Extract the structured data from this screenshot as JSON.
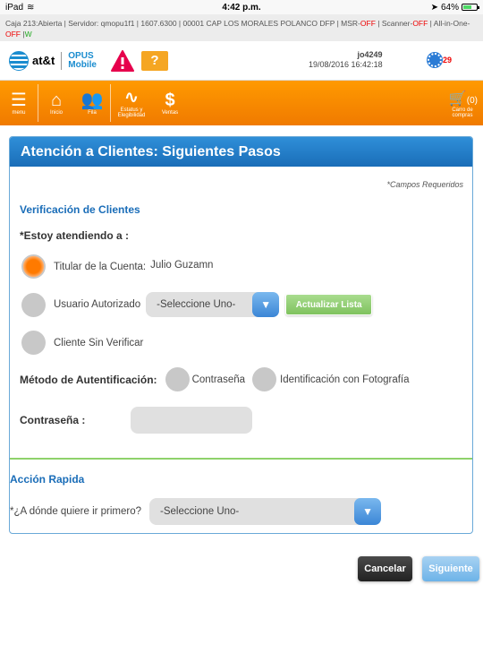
{
  "status_bar": {
    "device": "iPad",
    "time": "4:42 p.m.",
    "battery": "64%"
  },
  "info_strip": {
    "prefix": "Caja 213:Abierta  |  Servidor: qmopu1f1  |  1607.6300  |  00001 CAP LOS MORALES POLANCO DFP  |  MSR-",
    "msr": "OFF",
    "scanner_label": "  |  Scanner-",
    "scanner": "OFF",
    "allinone_label": "  |  All-in-One- ",
    "allinone": "OFF",
    "sep": " |",
    "w": "W"
  },
  "header": {
    "logo_brand": "at&t",
    "logo_product_1": "OPUS",
    "logo_product_2": "Mobile",
    "folder_symbol": "?",
    "username": "jo4249",
    "datetime": "19/08/2016 16:42:18",
    "notification_count": "29"
  },
  "nav": {
    "menu": "menu",
    "inicio": "Inicio",
    "fila": "Fila",
    "estatus": "Estatus y Elegibilidad",
    "ventas": "Ventas",
    "cart_count": "(0)",
    "cart_label": "Carro de compras"
  },
  "panel": {
    "title": "Atención a Clientes: Siguientes Pasos",
    "required_note": "*Campos Requeridos",
    "verification_title": "Verificación de Clientes",
    "attending_label": "*Estoy atendiendo a :",
    "option_titular": "Titular de la Cuenta:",
    "titular_name": "Julio Guzamn",
    "option_usuario": "Usuario Autorizado",
    "usuario_select": "-Seleccione Uno-",
    "refresh_button": "Actualizar Lista",
    "option_sin_verificar": "Cliente Sin Verificar",
    "auth_method_label": "Método de Autentificación:",
    "auth_password": "Contraseña",
    "auth_photo": "Identificación con Fotografía",
    "password_label": "Contraseña :",
    "quick_action_title": "Acción Rapida",
    "go_first_label": "*¿A dónde quiere ir primero?",
    "go_first_select": "-Seleccione Uno-"
  },
  "actions": {
    "cancel": "Cancelar",
    "next": "Siguiente"
  },
  "colors": {
    "accent_orange": "#ff8c00",
    "brand_blue": "#1a6db8",
    "alert_red": "#e6004c",
    "green": "#7fc25f"
  }
}
